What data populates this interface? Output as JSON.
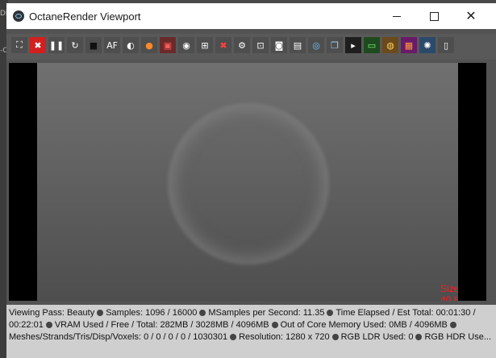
{
  "window": {
    "title": "OctaneRender Viewport"
  },
  "background": {
    "fragments": [
      "Di",
      "-C"
    ]
  },
  "toolbar": {
    "buttons": [
      {
        "name": "fit-view-icon",
        "glyph": "⛶",
        "bg": "#4e4e4e",
        "fg": "#ffffff"
      },
      {
        "name": "stop-render-icon",
        "glyph": "✖",
        "bg": "#d21f1f",
        "fg": "#ffffff"
      },
      {
        "name": "pause-icon",
        "glyph": "❚❚",
        "bg": "#4e4e4e",
        "fg": "#ffffff"
      },
      {
        "name": "restart-icon",
        "glyph": "↻",
        "bg": "#4e4e4e",
        "fg": "#ffffff"
      },
      {
        "name": "stop-icon",
        "glyph": "■",
        "bg": "#4e4e4e",
        "fg": "#111111"
      },
      {
        "name": "auto-focus-icon",
        "glyph": "AF",
        "bg": "#4e4e4e",
        "fg": "#ffffff"
      },
      {
        "name": "lock-icon",
        "glyph": "◐",
        "bg": "#4e4e4e",
        "fg": "#ffffff"
      },
      {
        "name": "color-picker-icon",
        "glyph": "●",
        "bg": "#4e4e4e",
        "fg": "#ff8a2a"
      },
      {
        "name": "region-render-icon",
        "glyph": "▣",
        "bg": "#6a2a2a",
        "fg": "#ff5a5a"
      },
      {
        "name": "camera-icon",
        "glyph": "◉",
        "bg": "#4e4e4e",
        "fg": "#ffffff"
      },
      {
        "name": "material-picker-icon",
        "glyph": "⊞",
        "bg": "#4e4e4e",
        "fg": "#ffffff"
      },
      {
        "name": "clear-icon",
        "glyph": "✖",
        "bg": "#4e4e4e",
        "fg": "#ff4040"
      },
      {
        "name": "settings-icon",
        "glyph": "⚙",
        "bg": "#4e4e4e",
        "fg": "#ffffff"
      },
      {
        "name": "focus-picker-icon",
        "glyph": "⊡",
        "bg": "#4e4e4e",
        "fg": "#ffffff"
      },
      {
        "name": "snapshot-icon",
        "glyph": "◙",
        "bg": "#4e4e4e",
        "fg": "#ffffff"
      },
      {
        "name": "save-image-icon",
        "glyph": "▤",
        "bg": "#4e4e4e",
        "fg": "#ffffff"
      },
      {
        "name": "export-icon",
        "glyph": "◎",
        "bg": "#4e4e4e",
        "fg": "#6ac8ff"
      },
      {
        "name": "layers-icon",
        "glyph": "❐",
        "bg": "#4e4e4e",
        "fg": "#9fd0ff"
      },
      {
        "name": "console-icon",
        "glyph": "▸",
        "bg": "#1e1e1e",
        "fg": "#ffffff"
      },
      {
        "name": "monitor-icon",
        "glyph": "▭",
        "bg": "#1f4a1f",
        "fg": "#7cff7c"
      },
      {
        "name": "portrait-icon",
        "glyph": "◍",
        "bg": "#6a4a1a",
        "fg": "#ffcc66"
      },
      {
        "name": "checker-icon",
        "glyph": "▦",
        "bg": "#6a1a6a",
        "fg": "#ff9a3a"
      },
      {
        "name": "gear-world-icon",
        "glyph": "✺",
        "bg": "#2a4a6a",
        "fg": "#ffffff"
      },
      {
        "name": "document-icon",
        "glyph": "▯",
        "bg": "#4e4e4e",
        "fg": "#ffffff"
      }
    ]
  },
  "viewport": {
    "size_label": "Size : 40.83%"
  },
  "status": {
    "lines": [
      [
        "Viewing Pass: Beauty",
        "Samples: 1096  / 16000",
        "MSamples per Second: 11.35",
        "Time Elapsed / Est Total: 00:01:30 /"
      ],
      [
        "00:22:01",
        "VRAM Used / Free / Total: 282MB / 3028MB / 4096MB",
        "Out of Core Memory Used: 0MB / 4096MB",
        ""
      ],
      [
        "Meshes/Strands/Tris/Disp/Voxels: 0 / 0 / 0 / 0 / 1030301",
        "Resolution: 1280 x 720",
        "RGB LDR Used: 0",
        "RGB HDR Use..."
      ]
    ]
  }
}
